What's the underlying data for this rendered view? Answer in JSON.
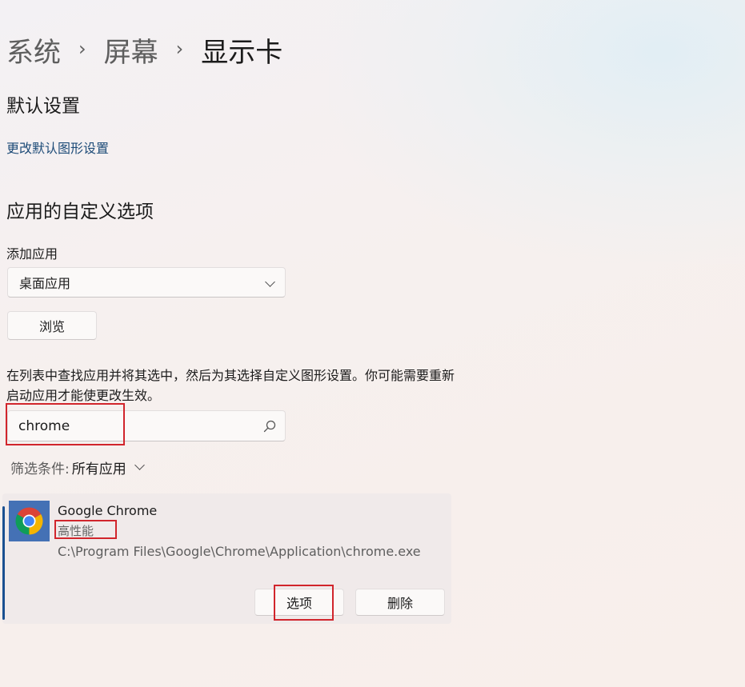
{
  "breadcrumb": {
    "items": [
      "系统",
      "屏幕",
      "显示卡"
    ],
    "separator": "›"
  },
  "default_settings": {
    "heading": "默认设置",
    "link": "更改默认图形设置"
  },
  "custom_options": {
    "heading": "应用的自定义选项",
    "add_app_label": "添加应用",
    "app_type_selected": "桌面应用",
    "browse_label": "浏览",
    "description": "在列表中查找应用并将其选中，然后为其选择自定义图形设置。你可能需要重新启动应用才能使更改生效。",
    "search_value": "chrome",
    "filter_label": "筛选条件:",
    "filter_value": "所有应用"
  },
  "app_entry": {
    "name": "Google Chrome",
    "preference": "高性能",
    "path": "C:\\Program Files\\Google\\Chrome\\Application\\chrome.exe",
    "options_label": "选项",
    "remove_label": "删除"
  },
  "colors": {
    "accent": "#1a5091",
    "link": "#1d4b78",
    "highlight": "#d1252c"
  }
}
